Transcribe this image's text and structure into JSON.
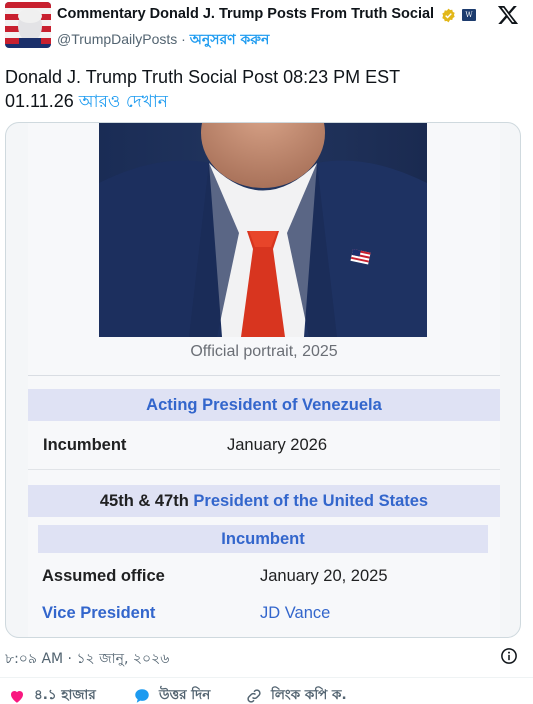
{
  "author": {
    "name": "Commentary Donald J. Trump Posts From Truth Social",
    "handle": "@TrumpDailyPosts",
    "separator": "·",
    "follow_label": "অনুসরণ করুন",
    "badge_text": "W"
  },
  "tweet": {
    "text_line1": "Donald J. Trump Truth Social Post 08:23 PM EST",
    "text_line2": "01.11.26",
    "show_more": "আরও দেখান"
  },
  "card": {
    "caption": "Official portrait, 2025",
    "section1_title": "Acting President of Venezuela",
    "row1_label": "Incumbent",
    "row1_value": "January 2026",
    "section2_prefix": "45th & 47th",
    "section2_link": "President of the United States",
    "section2_sub": "Incumbent",
    "row2_label": "Assumed office",
    "row2_value": "January 20, 2025",
    "row3_label": "Vice President",
    "row3_value": "JD Vance"
  },
  "footer": {
    "timestamp": "৮:০৯ AM · ১২ জানু, ২০২৬"
  },
  "actions": {
    "likes": "৪.১ হাজার",
    "reply": "উত্তর দিন",
    "copy_link": "লিংক কপি ক."
  },
  "colors": {
    "accent": "#1d9bf0",
    "wiki_link": "#3366cc",
    "band": "#dfe2f4",
    "like": "#f91880"
  }
}
